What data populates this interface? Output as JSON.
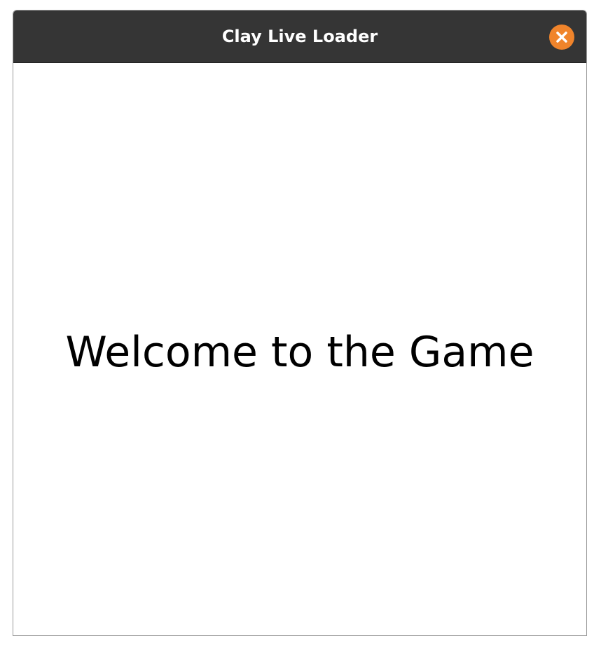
{
  "window": {
    "title": "Clay Live Loader",
    "close_icon": "close-icon",
    "close_color": "#f0842b",
    "titlebar_color": "#353535"
  },
  "content": {
    "message": "Welcome to the Game"
  }
}
